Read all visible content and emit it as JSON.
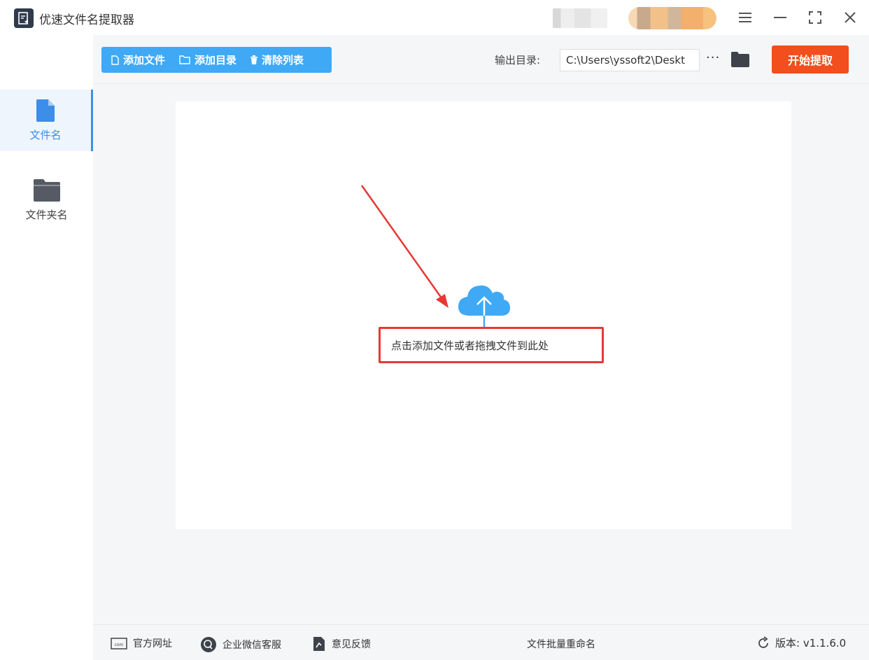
{
  "app": {
    "title": "优速文件名提取器"
  },
  "window": {
    "menu_icon": "menu-icon",
    "minimize_icon": "minimize-icon",
    "maximize_icon": "maximize-icon",
    "close_icon": "close-icon"
  },
  "sidebar": {
    "items": [
      {
        "label": "文件名",
        "icon": "file-icon",
        "active": true
      },
      {
        "label": "文件夹名",
        "icon": "folder-icon",
        "active": false
      }
    ]
  },
  "toolbar": {
    "add_file": "添加文件",
    "add_dir": "添加目录",
    "clear_list": "清除列表",
    "output_label": "输出目录:",
    "output_path": "C:\\Users\\yssoft2\\Deskt",
    "more": "···",
    "start": "开始提取"
  },
  "dropzone": {
    "hint": "点击添加文件或者拖拽文件到此处",
    "icon": "cloud-upload-icon"
  },
  "footer": {
    "website": "官方网址",
    "wechat": "企业微信客服",
    "feedback": "意见反馈",
    "center": "文件批量重命名",
    "version": "版本: v1.1.6.0"
  },
  "colors": {
    "accent_blue": "#3fa9f5",
    "sidebar_active": "#3c8ee8",
    "start_button": "#f24e1e",
    "highlight_red": "#e53935"
  }
}
